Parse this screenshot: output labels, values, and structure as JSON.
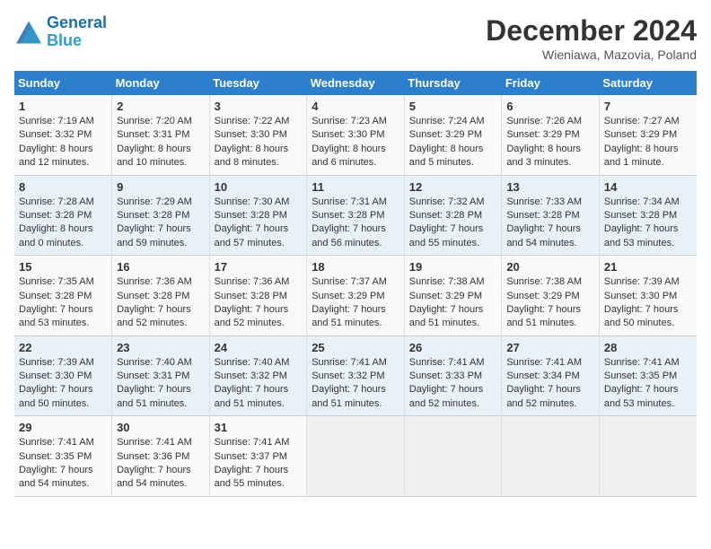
{
  "header": {
    "logo_line1": "General",
    "logo_line2": "Blue",
    "title": "December 2024",
    "subtitle": "Wieniawa, Mazovia, Poland"
  },
  "weekdays": [
    "Sunday",
    "Monday",
    "Tuesday",
    "Wednesday",
    "Thursday",
    "Friday",
    "Saturday"
  ],
  "weeks": [
    [
      {
        "day": "1",
        "info": "Sunrise: 7:19 AM\nSunset: 3:32 PM\nDaylight: 8 hours\nand 12 minutes."
      },
      {
        "day": "2",
        "info": "Sunrise: 7:20 AM\nSunset: 3:31 PM\nDaylight: 8 hours\nand 10 minutes."
      },
      {
        "day": "3",
        "info": "Sunrise: 7:22 AM\nSunset: 3:30 PM\nDaylight: 8 hours\nand 8 minutes."
      },
      {
        "day": "4",
        "info": "Sunrise: 7:23 AM\nSunset: 3:30 PM\nDaylight: 8 hours\nand 6 minutes."
      },
      {
        "day": "5",
        "info": "Sunrise: 7:24 AM\nSunset: 3:29 PM\nDaylight: 8 hours\nand 5 minutes."
      },
      {
        "day": "6",
        "info": "Sunrise: 7:26 AM\nSunset: 3:29 PM\nDaylight: 8 hours\nand 3 minutes."
      },
      {
        "day": "7",
        "info": "Sunrise: 7:27 AM\nSunset: 3:29 PM\nDaylight: 8 hours\nand 1 minute."
      }
    ],
    [
      {
        "day": "8",
        "info": "Sunrise: 7:28 AM\nSunset: 3:28 PM\nDaylight: 8 hours\nand 0 minutes."
      },
      {
        "day": "9",
        "info": "Sunrise: 7:29 AM\nSunset: 3:28 PM\nDaylight: 7 hours\nand 59 minutes."
      },
      {
        "day": "10",
        "info": "Sunrise: 7:30 AM\nSunset: 3:28 PM\nDaylight: 7 hours\nand 57 minutes."
      },
      {
        "day": "11",
        "info": "Sunrise: 7:31 AM\nSunset: 3:28 PM\nDaylight: 7 hours\nand 56 minutes."
      },
      {
        "day": "12",
        "info": "Sunrise: 7:32 AM\nSunset: 3:28 PM\nDaylight: 7 hours\nand 55 minutes."
      },
      {
        "day": "13",
        "info": "Sunrise: 7:33 AM\nSunset: 3:28 PM\nDaylight: 7 hours\nand 54 minutes."
      },
      {
        "day": "14",
        "info": "Sunrise: 7:34 AM\nSunset: 3:28 PM\nDaylight: 7 hours\nand 53 minutes."
      }
    ],
    [
      {
        "day": "15",
        "info": "Sunrise: 7:35 AM\nSunset: 3:28 PM\nDaylight: 7 hours\nand 53 minutes."
      },
      {
        "day": "16",
        "info": "Sunrise: 7:36 AM\nSunset: 3:28 PM\nDaylight: 7 hours\nand 52 minutes."
      },
      {
        "day": "17",
        "info": "Sunrise: 7:36 AM\nSunset: 3:28 PM\nDaylight: 7 hours\nand 52 minutes."
      },
      {
        "day": "18",
        "info": "Sunrise: 7:37 AM\nSunset: 3:29 PM\nDaylight: 7 hours\nand 51 minutes."
      },
      {
        "day": "19",
        "info": "Sunrise: 7:38 AM\nSunset: 3:29 PM\nDaylight: 7 hours\nand 51 minutes."
      },
      {
        "day": "20",
        "info": "Sunrise: 7:38 AM\nSunset: 3:29 PM\nDaylight: 7 hours\nand 51 minutes."
      },
      {
        "day": "21",
        "info": "Sunrise: 7:39 AM\nSunset: 3:30 PM\nDaylight: 7 hours\nand 50 minutes."
      }
    ],
    [
      {
        "day": "22",
        "info": "Sunrise: 7:39 AM\nSunset: 3:30 PM\nDaylight: 7 hours\nand 50 minutes."
      },
      {
        "day": "23",
        "info": "Sunrise: 7:40 AM\nSunset: 3:31 PM\nDaylight: 7 hours\nand 51 minutes."
      },
      {
        "day": "24",
        "info": "Sunrise: 7:40 AM\nSunset: 3:32 PM\nDaylight: 7 hours\nand 51 minutes."
      },
      {
        "day": "25",
        "info": "Sunrise: 7:41 AM\nSunset: 3:32 PM\nDaylight: 7 hours\nand 51 minutes."
      },
      {
        "day": "26",
        "info": "Sunrise: 7:41 AM\nSunset: 3:33 PM\nDaylight: 7 hours\nand 52 minutes."
      },
      {
        "day": "27",
        "info": "Sunrise: 7:41 AM\nSunset: 3:34 PM\nDaylight: 7 hours\nand 52 minutes."
      },
      {
        "day": "28",
        "info": "Sunrise: 7:41 AM\nSunset: 3:35 PM\nDaylight: 7 hours\nand 53 minutes."
      }
    ],
    [
      {
        "day": "29",
        "info": "Sunrise: 7:41 AM\nSunset: 3:35 PM\nDaylight: 7 hours\nand 54 minutes."
      },
      {
        "day": "30",
        "info": "Sunrise: 7:41 AM\nSunset: 3:36 PM\nDaylight: 7 hours\nand 54 minutes."
      },
      {
        "day": "31",
        "info": "Sunrise: 7:41 AM\nSunset: 3:37 PM\nDaylight: 7 hours\nand 55 minutes."
      },
      {
        "day": "",
        "info": ""
      },
      {
        "day": "",
        "info": ""
      },
      {
        "day": "",
        "info": ""
      },
      {
        "day": "",
        "info": ""
      }
    ]
  ]
}
